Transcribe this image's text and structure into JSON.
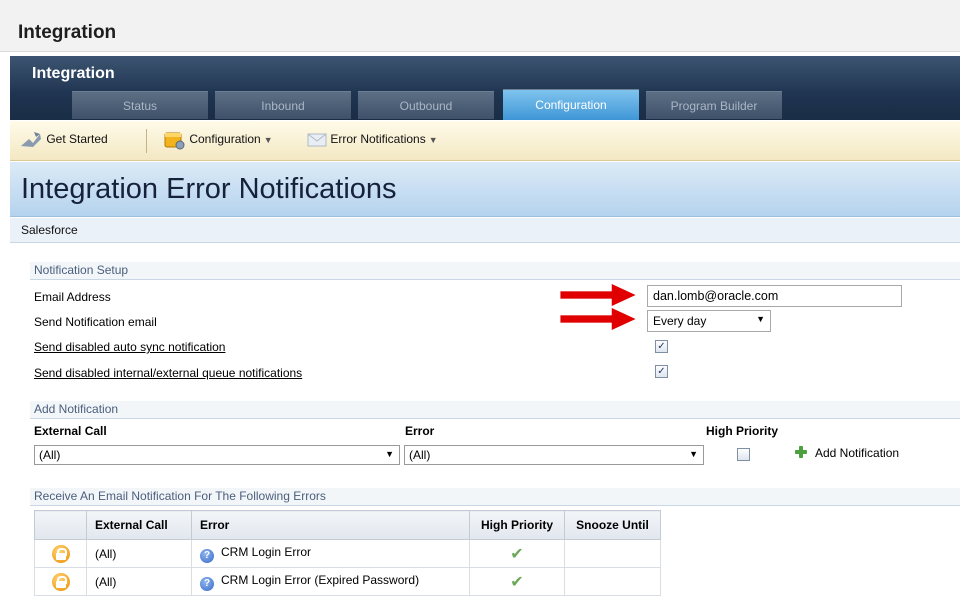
{
  "app": {
    "title": "Integration",
    "header_title": "Integration"
  },
  "tabs": [
    {
      "label": "Status",
      "active": false
    },
    {
      "label": "Inbound",
      "active": false
    },
    {
      "label": "Outbound",
      "active": false
    },
    {
      "label": "Configuration",
      "active": true
    },
    {
      "label": "Program Builder",
      "active": false
    }
  ],
  "toolbar": {
    "get_started": "Get Started",
    "configuration": "Configuration",
    "error_notifications": "Error Notifications"
  },
  "page": {
    "title": "Integration Error Notifications",
    "subtitle": "Salesforce"
  },
  "notification_setup": {
    "section_label": "Notification Setup",
    "email_label": "Email Address",
    "email_value": "dan.lomb@oracle.com",
    "send_email_label": "Send Notification email",
    "send_email_value": "Every day",
    "auto_sync_label": "Send disabled auto sync notification",
    "auto_sync_checked": true,
    "queue_label": "Send disabled internal/external queue notifications",
    "queue_checked": true
  },
  "add_notification": {
    "section_label": "Add Notification",
    "external_call_header": "External Call",
    "error_header": "Error",
    "high_priority_header": "High Priority",
    "external_call_value": "(All)",
    "error_value": "(All)",
    "high_priority_checked": false,
    "add_button": "Add Notification"
  },
  "errors_table": {
    "section_label": "Receive An Email Notification For The Following Errors",
    "columns": [
      "External Call",
      "Error",
      "High Priority",
      "Snooze Until"
    ],
    "rows": [
      {
        "external_call": "(All)",
        "error": "CRM Login Error",
        "high_priority": true,
        "snooze_until": ""
      },
      {
        "external_call": "(All)",
        "error": "CRM Login Error (Expired Password)",
        "high_priority": true,
        "snooze_until": ""
      }
    ]
  },
  "colors": {
    "accent_tab": "#3f96d6",
    "header_dark": "#1f3450",
    "arrow": "#e00000",
    "check": "#6ba85a"
  }
}
